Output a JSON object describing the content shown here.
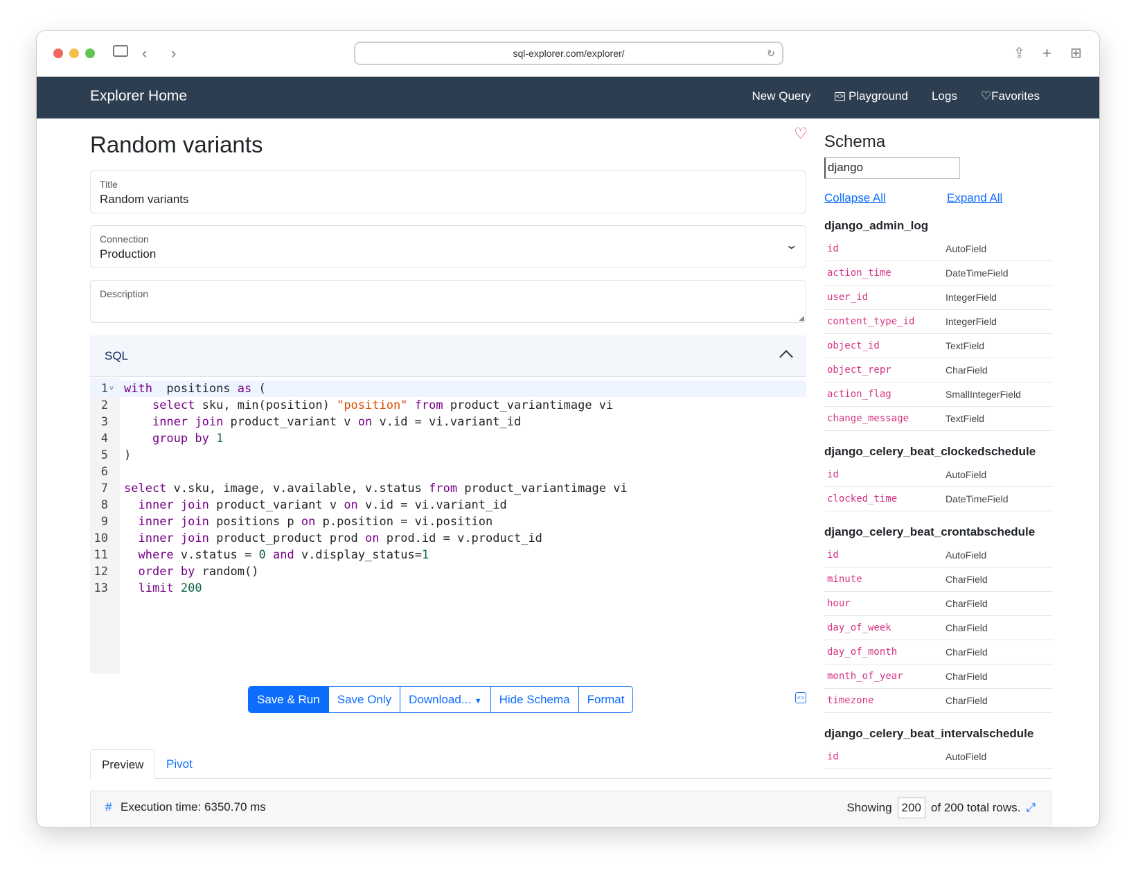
{
  "browser": {
    "url": "sql-explorer.com/explorer/"
  },
  "nav": {
    "brand": "Explorer Home",
    "links": [
      "New Query",
      "Playground",
      "Logs",
      "Favorites"
    ]
  },
  "page": {
    "title": "Random variants"
  },
  "form": {
    "title": {
      "label": "Title",
      "value": "Random variants"
    },
    "connection": {
      "label": "Connection",
      "value": "Production"
    },
    "description": {
      "label": "Description",
      "value": ""
    }
  },
  "sql": {
    "header": "SQL",
    "lines": [
      [
        [
          "kw",
          "with"
        ],
        [
          "",
          "  positions "
        ],
        [
          "kw",
          "as"
        ],
        [
          "",
          " ("
        ]
      ],
      [
        [
          "",
          "    "
        ],
        [
          "kw",
          "select"
        ],
        [
          "",
          " sku, min(position) "
        ],
        [
          "str",
          "\"position\""
        ],
        [
          "",
          " "
        ],
        [
          "kw",
          "from"
        ],
        [
          "",
          " product_variantimage vi"
        ]
      ],
      [
        [
          "",
          "    "
        ],
        [
          "kw",
          "inner join"
        ],
        [
          "",
          " product_variant v "
        ],
        [
          "kw",
          "on"
        ],
        [
          "",
          " v.id = vi.variant_id"
        ]
      ],
      [
        [
          "",
          "    "
        ],
        [
          "kw",
          "group by"
        ],
        [
          "",
          " "
        ],
        [
          "num",
          "1"
        ]
      ],
      [
        [
          "",
          ")"
        ]
      ],
      [
        [
          "",
          ""
        ]
      ],
      [
        [
          "kw",
          "select"
        ],
        [
          "",
          " v.sku, image, v.available, v.status "
        ],
        [
          "kw",
          "from"
        ],
        [
          "",
          " product_variantimage vi"
        ]
      ],
      [
        [
          "",
          "  "
        ],
        [
          "kw",
          "inner join"
        ],
        [
          "",
          " product_variant v "
        ],
        [
          "kw",
          "on"
        ],
        [
          "",
          " v.id = vi.variant_id"
        ]
      ],
      [
        [
          "",
          "  "
        ],
        [
          "kw",
          "inner join"
        ],
        [
          "",
          " positions p "
        ],
        [
          "kw",
          "on"
        ],
        [
          "",
          " p.position = vi.position"
        ]
      ],
      [
        [
          "",
          "  "
        ],
        [
          "kw",
          "inner join"
        ],
        [
          "",
          " product_product prod "
        ],
        [
          "kw",
          "on"
        ],
        [
          "",
          " prod.id = v.product_id"
        ]
      ],
      [
        [
          "",
          "  "
        ],
        [
          "kw",
          "where"
        ],
        [
          "",
          " v.status = "
        ],
        [
          "num",
          "0"
        ],
        [
          "",
          " "
        ],
        [
          "kw",
          "and"
        ],
        [
          "",
          " v.display_status="
        ],
        [
          "num",
          "1"
        ]
      ],
      [
        [
          "",
          "  "
        ],
        [
          "kw",
          "order by"
        ],
        [
          "",
          " random()"
        ]
      ],
      [
        [
          "",
          "  "
        ],
        [
          "kw",
          "limit"
        ],
        [
          "",
          " "
        ],
        [
          "num",
          "200"
        ]
      ]
    ]
  },
  "buttons": [
    "Save & Run",
    "Save Only",
    "Download...",
    "Hide Schema",
    "Format"
  ],
  "tabs": [
    "Preview",
    "Pivot"
  ],
  "results": {
    "execution": "Execution time: 6350.70 ms",
    "showing_label": "Showing",
    "showing_value": "200",
    "total": "of 200 total rows."
  },
  "schema": {
    "title": "Schema",
    "search": "django",
    "collapse": "Collapse All",
    "expand": "Expand All",
    "tables": [
      {
        "name": "django_admin_log",
        "fields": [
          [
            "id",
            "AutoField"
          ],
          [
            "action_time",
            "DateTimeField"
          ],
          [
            "user_id",
            "IntegerField"
          ],
          [
            "content_type_id",
            "IntegerField"
          ],
          [
            "object_id",
            "TextField"
          ],
          [
            "object_repr",
            "CharField"
          ],
          [
            "action_flag",
            "SmallIntegerField"
          ],
          [
            "change_message",
            "TextField"
          ]
        ]
      },
      {
        "name": "django_celery_beat_clockedschedule",
        "fields": [
          [
            "id",
            "AutoField"
          ],
          [
            "clocked_time",
            "DateTimeField"
          ]
        ]
      },
      {
        "name": "django_celery_beat_crontabschedule",
        "fields": [
          [
            "id",
            "AutoField"
          ],
          [
            "minute",
            "CharField"
          ],
          [
            "hour",
            "CharField"
          ],
          [
            "day_of_week",
            "CharField"
          ],
          [
            "day_of_month",
            "CharField"
          ],
          [
            "month_of_year",
            "CharField"
          ],
          [
            "timezone",
            "CharField"
          ]
        ]
      },
      {
        "name": "django_celery_beat_intervalschedule",
        "fields": [
          [
            "id",
            "AutoField"
          ]
        ]
      }
    ]
  },
  "colors": {
    "nav": "#2c3e50",
    "primary": "#0d6efd",
    "field": "#d63384",
    "favorite": "#dc3545"
  }
}
